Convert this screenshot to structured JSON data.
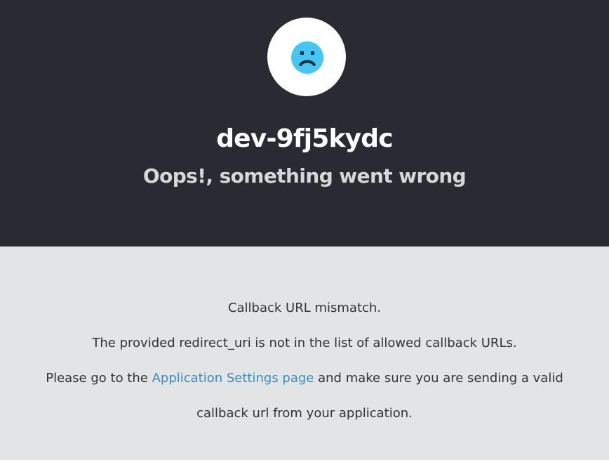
{
  "header": {
    "tenant_name": "dev-9fj5kydc",
    "error_title": "Oops!, something went wrong",
    "icon": "sad-face-icon",
    "background_color": "#2a2b32",
    "icon_color": "#44c7f4"
  },
  "message": {
    "line1": "Callback URL mismatch.",
    "line2": "The provided redirect_uri is not in the list of allowed callback URLs.",
    "line3_before": "Please go to the ",
    "line3_link": "Application Settings page",
    "line3_after": " and make sure you are sending a valid",
    "line4": "callback url from your application.",
    "link_color": "#3a8fb7",
    "background_color": "#e3e4e6"
  }
}
